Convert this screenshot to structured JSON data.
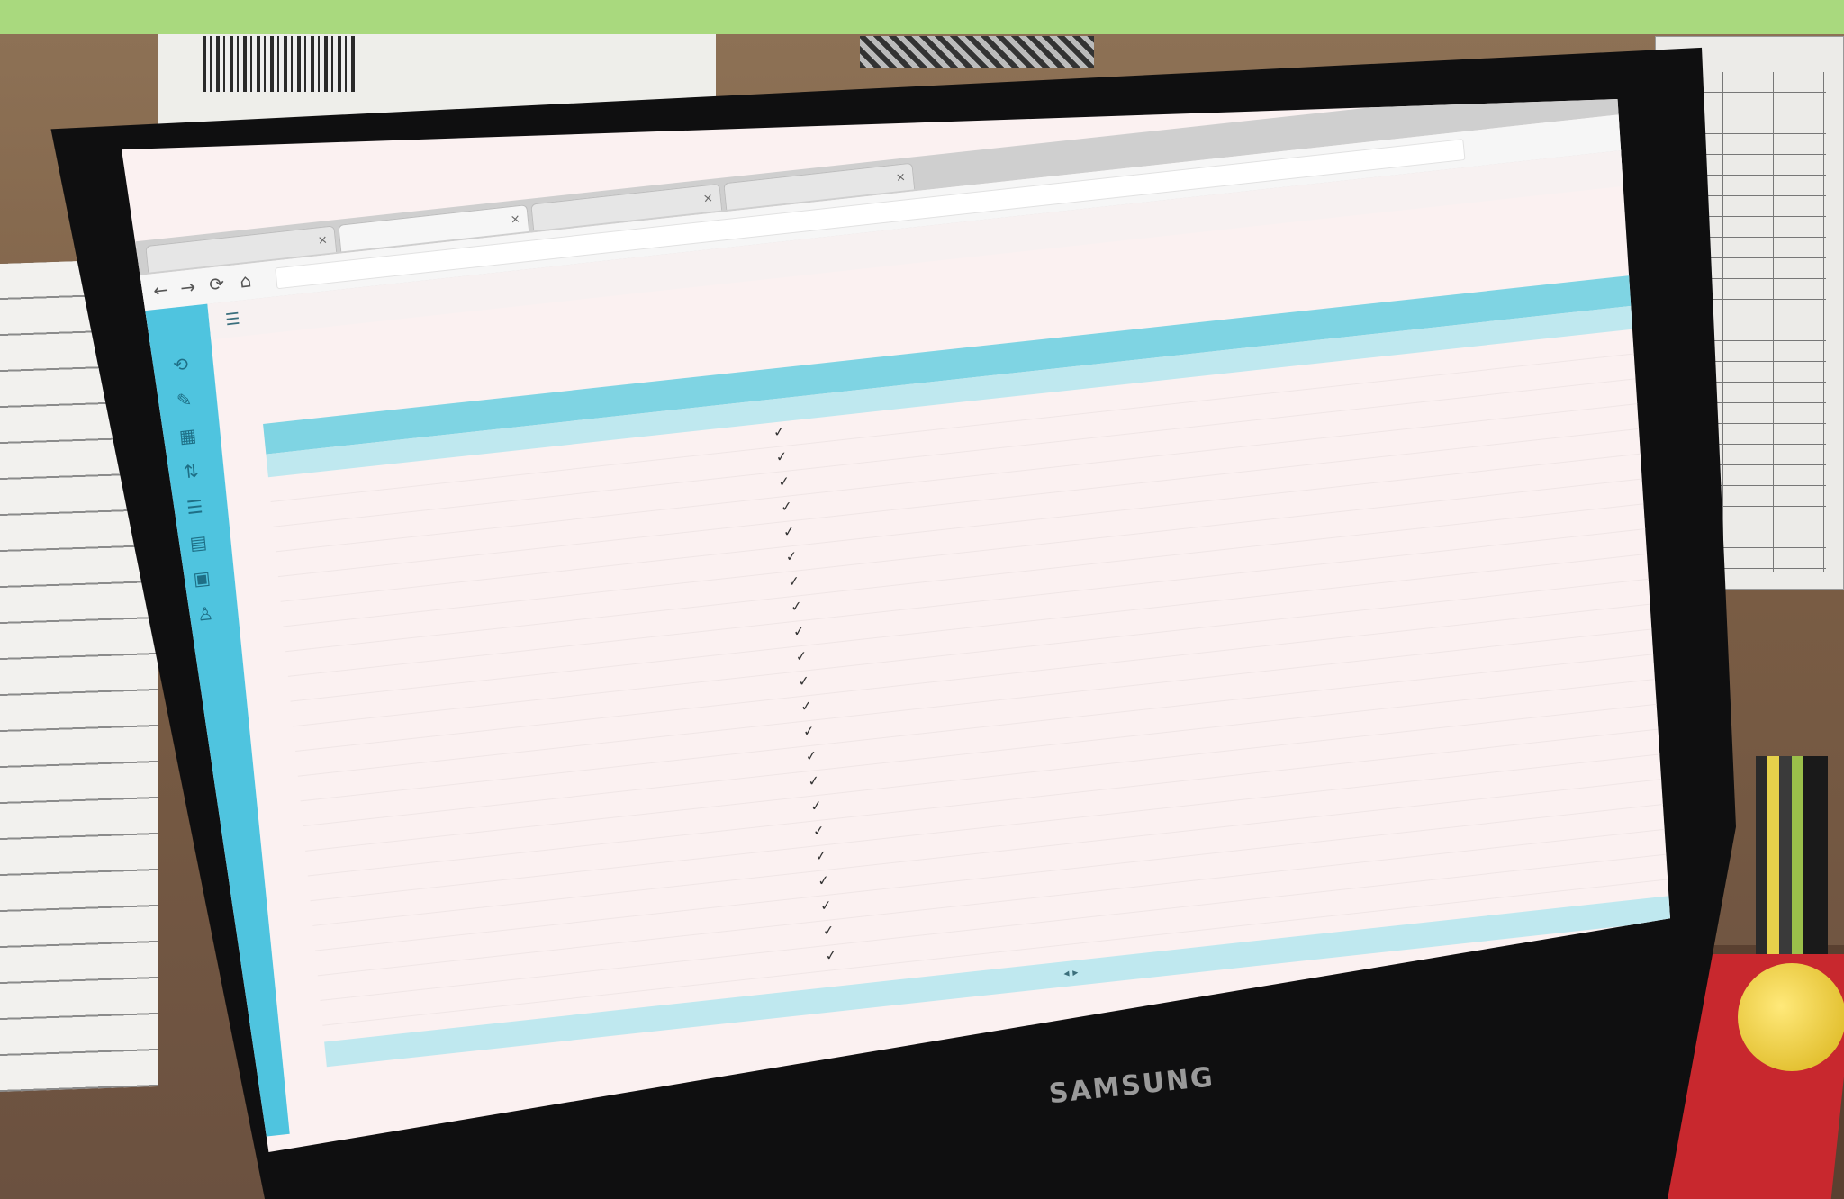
{
  "scene": {
    "monitor_brand": "SAMSUNG"
  },
  "browser": {
    "tabs": [
      {
        "label": "",
        "active": false
      },
      {
        "label": "",
        "active": true
      },
      {
        "label": "",
        "active": false
      },
      {
        "label": "",
        "active": false
      }
    ],
    "url": ""
  },
  "app": {
    "breadcrumb": [
      "",
      ""
    ],
    "subtabs": [
      "",
      "",
      "",
      "",
      ""
    ],
    "toolbar_actions": [
      "",
      "",
      "",
      "",
      "",
      ""
    ],
    "columns": [
      "",
      "",
      "",
      "",
      "",
      "",
      "",
      "",
      "",
      "",
      "",
      "",
      "",
      "",
      "",
      "",
      "",
      "",
      "",
      "",
      ""
    ],
    "filter_row": [
      "",
      "",
      "",
      "",
      "",
      "",
      "",
      "",
      "",
      "",
      ""
    ],
    "rows_shown": 22,
    "check_mark": "✓",
    "footer": ""
  }
}
